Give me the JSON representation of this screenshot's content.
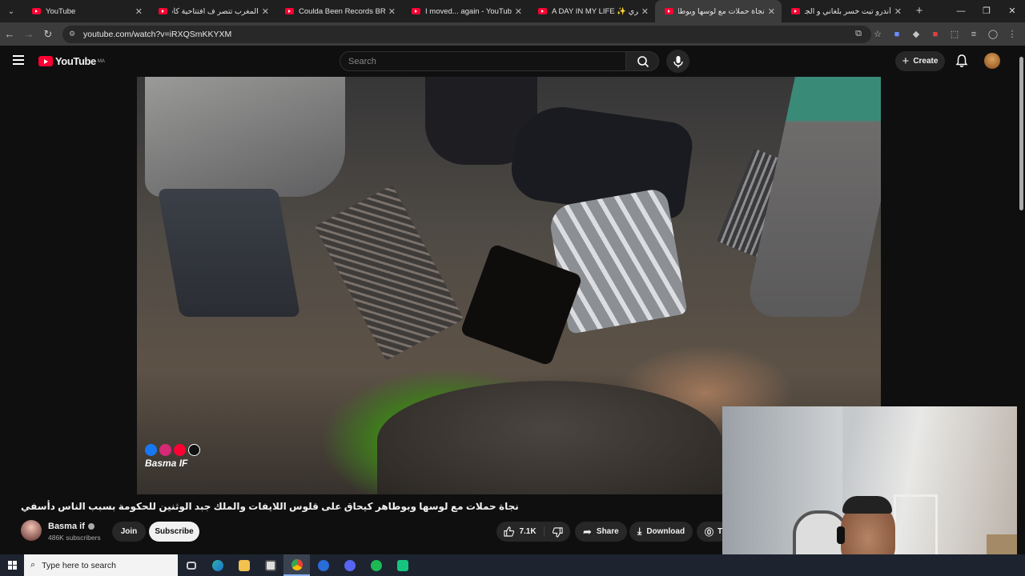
{
  "browser": {
    "tabs": [
      {
        "title": "YouTube",
        "active": false
      },
      {
        "title": "المغرب تتصر ف افتتاحية كأس الأ",
        "active": false
      },
      {
        "title": "Coulda Been Records BROOKLYN",
        "active": false
      },
      {
        "title": "I moved... again - YouTube",
        "active": false
      },
      {
        "title": "A DAY IN MY LIFE ✨ بحث شعري",
        "active": false
      },
      {
        "title": "نجاة حملات مع لوسها ويوطا",
        "active": true
      },
      {
        "title": "أندرو تيت خسر بلغاني و الجمهور",
        "active": false
      }
    ],
    "new_tab": "+",
    "url": "youtube.com/watch?v=iRXQSmKKYXM"
  },
  "youtube": {
    "logo_text": "YouTube",
    "region": "MA",
    "search_placeholder": "Search",
    "create_label": "Create"
  },
  "video": {
    "watermark": "Basma IF",
    "title": "نجاة حملات مع لوسها وبوطاهر كيحاق على قلوس اللايفات والملك جبد الوثنين للحكومة بسبب الناس دأسفي",
    "channel": {
      "name": "Basma if",
      "subscribers": "486K subscribers"
    },
    "join_label": "Join",
    "subscribe_label": "Subscribe",
    "likes": "7.1K",
    "share_label": "Share",
    "download_label": "Download",
    "thanks_label": "Th"
  },
  "taskbar": {
    "search_placeholder": "Type here to search"
  },
  "colors": {
    "accent": "#ff0033",
    "background": "#0f0f0f"
  }
}
